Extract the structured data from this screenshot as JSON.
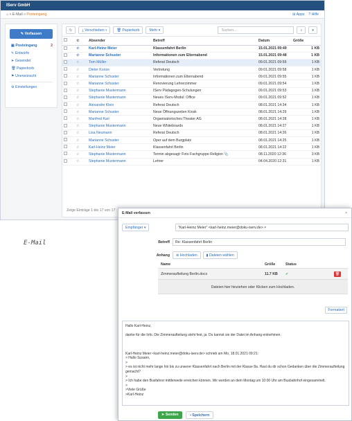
{
  "app": {
    "org": "IServ GmbH"
  },
  "breadcrumb": {
    "home": "⌂",
    "email": "E-Mail",
    "folder": "Posteingang",
    "apps": "Apps",
    "help": "Hilfe"
  },
  "sidebar": {
    "compose": "Verfassen",
    "items": [
      {
        "label": "Posteingang",
        "count": "2"
      },
      {
        "label": "Entwürfe"
      },
      {
        "label": "Gesendet"
      },
      {
        "label": "Papierkorb"
      },
      {
        "label": "Unerwünscht"
      },
      {
        "label": "Einstellungen"
      }
    ]
  },
  "toolbar": {
    "move": "Verschieben",
    "trash": "Papierkorb",
    "more": "Mehr",
    "search_placeholder": "Suchen..."
  },
  "table": {
    "headers": {
      "sender": "Absender",
      "subject": "Betreff",
      "date": "Datum",
      "size": "Größe"
    },
    "rows": [
      {
        "sender": "Karl-Heinz Meier",
        "subject": "Klassenfahrt Berlin",
        "date": "15.01.2021 09:49",
        "size": "1 KB",
        "unread": true
      },
      {
        "sender": "Marianne Schuster",
        "subject": "Informationen zum Elternabend",
        "date": "15.01.2021 09:48",
        "size": "1 KB",
        "unread": true
      },
      {
        "sender": "Tom Müller",
        "subject": "Referat Deutsch",
        "date": "09.01.2021 09:59",
        "size": "1 KB",
        "sel": true
      },
      {
        "sender": "Dieter Kunze",
        "subject": "Vertretung",
        "date": "09.01.2021 09:58",
        "size": "1 KB"
      },
      {
        "sender": "Marianne Schuster",
        "subject": "Informationen zum Elternabend",
        "date": "09.01.2021 09:55",
        "size": "1 KB"
      },
      {
        "sender": "Marianne Schuster",
        "subject": "Renovierung Lehrerzimmer",
        "date": "09.01.2021 09:54",
        "size": "1 KB"
      },
      {
        "sender": "Stephanie Mustermann",
        "subject": "IServ Pädagogen-Schulungen",
        "date": "09.01.2021 09:53",
        "size": "1 KB"
      },
      {
        "sender": "Stephanie Mustermann",
        "subject": "Neues IServ-Modul: Office",
        "date": "09.01.2021 09:52",
        "size": "1 KB"
      },
      {
        "sender": "Alexandre Klein",
        "subject": "Referat Deutsch",
        "date": "08.01.2021 14:34",
        "size": "1 KB"
      },
      {
        "sender": "Marianne Schuster",
        "subject": "Neue Öffnungszeiten Kiosk",
        "date": "08.01.2021 14:29",
        "size": "1 KB"
      },
      {
        "sender": "Manfred Karl",
        "subject": "Organisatorisches:Theater AG",
        "date": "08.01.2021 14:28",
        "size": "1 KB"
      },
      {
        "sender": "Stephanie Mustermann",
        "subject": "Neue Whiteboards",
        "date": "08.01.2021 14:27",
        "size": "1 KB"
      },
      {
        "sender": "Lisa Neumann",
        "subject": "Referat Deutsch",
        "date": "08.01.2021 14:26",
        "size": "1 KB"
      },
      {
        "sender": "Marianne Schuster",
        "subject": "Oper auf dem Burgplatz",
        "date": "08.01.2021 14:25",
        "size": "1 KB"
      },
      {
        "sender": "Karl-Heinz Meier",
        "subject": "Klassenfahrt Berlin",
        "date": "08.01.2021 14:22",
        "size": "1 KB"
      },
      {
        "sender": "Stephanie Mustermann",
        "subject": "Termin abgesagt: Foto Fachgruppe Religion",
        "date": "08.11.2020 12:36",
        "size": "3 KB",
        "clip": true
      },
      {
        "sender": "Stephanie Mustermann",
        "subject": "Lehrer",
        "date": "04.04.2020 12:31",
        "size": "1 KB"
      }
    ],
    "footer": "Zeige Einträge 1 bis 17 von 17"
  },
  "caption": "E-Mail",
  "compose": {
    "title": "E-Mail verfassen",
    "to_label": "Empfänger",
    "to_value": "\"Karl-Heinz Meier\" <karl-heinz.meier@doku-iserv.de>",
    "subject_label": "Betreff",
    "subject_value": "Re: Klassenfahrt Berlin",
    "attach_label": "Anhang",
    "upload_btn": "Hochladen",
    "choose_btn": "Dateien wählen",
    "att_headers": {
      "name": "Name",
      "size": "Größe",
      "status": "Status"
    },
    "att_file": {
      "name": "Zimmeraufteilung Berlin.docx",
      "size": "11.7 KB"
    },
    "drop_text": "Dateien hier hinziehen oder Klicken zum Hochladen.",
    "format_btn": "Formatiert",
    "body": "Hallo Karl-Heinz,\n\ndanke für die Info. Die Zimmeraufteilung steht fest, ja. Du kannst sie der Datei im Anhang entnehmen.\n\n\n\nKarl-Heinz Meier <karl-heinz.meier@doku-iserv.de> schrieb am Mo, 18.01.2021 09:21:\n> Hallo Susann,\n>\n> es ist nicht mehr lange hin bis zu unserer Klassenfahrt nach Berlin mit der Klasse 8a. Hast du dir schon Gedanken über die Zimmeraufteilung gemacht?\n>\n> Ich habe den Busfahrer mittlerweile erreichen können. Wir werden an dem Montag um 10:00 Uhr am Busbahnhof eingesammelt.\n>\n>Viele Grüße\n>Karl-Heinz",
    "send_btn": "Senden",
    "save_btn": "Speichern"
  }
}
